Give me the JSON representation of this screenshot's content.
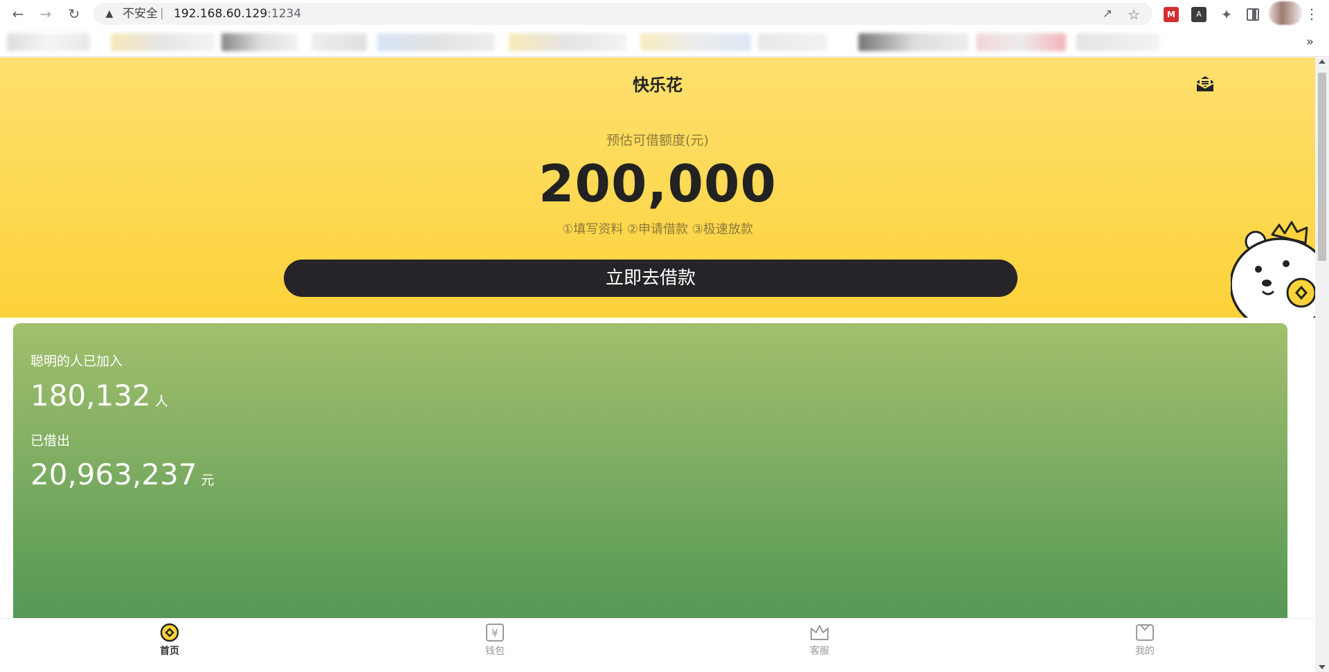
{
  "browser": {
    "security_label": "不安全",
    "url_host": "192.168.60.129",
    "url_port": ":1234",
    "more_bookmarks": "»"
  },
  "app": {
    "title": "快乐花",
    "limit_label": "预估可借额度(元)",
    "limit_amount": "200,000",
    "steps": "①填写资料 ②申请借款 ③极速放款",
    "borrow_button": "立即去借款"
  },
  "stats": {
    "joined_label": "聪明的人已加入",
    "joined_value": "180,132",
    "joined_unit": "人",
    "lent_label": "已借出",
    "lent_value": "20,963,237",
    "lent_unit": "元"
  },
  "tabbar": {
    "items": [
      {
        "label": "首页",
        "icon": "home-coin-icon",
        "active": true
      },
      {
        "label": "钱包",
        "icon": "wallet-yen-icon",
        "active": false
      },
      {
        "label": "客服",
        "icon": "customer-service-crown-icon",
        "active": false
      },
      {
        "label": "我的",
        "icon": "profile-icon",
        "active": false
      }
    ]
  },
  "colors": {
    "hero_top": "#fee06f",
    "hero_bottom": "#fcd23a",
    "button_bg": "#262428",
    "card_top": "#a2bf6c",
    "card_bottom": "#498f50",
    "tab_active": "#fcd23a"
  }
}
